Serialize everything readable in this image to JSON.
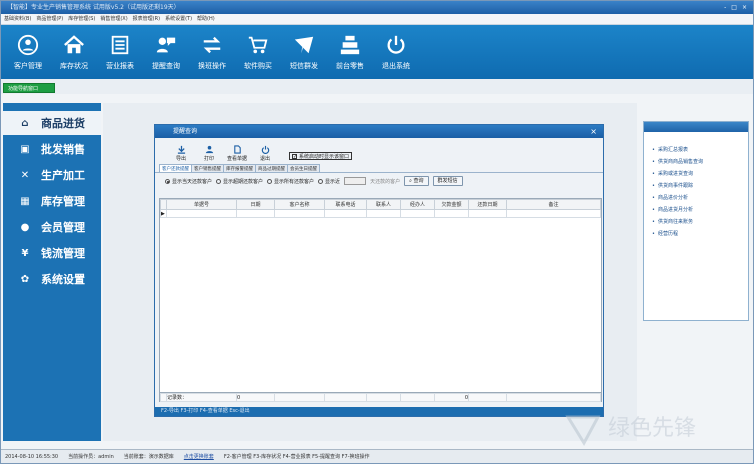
{
  "window": {
    "title": "【智能】专业生产销售管理系统  试用版v5.2（试用版还剩19天）",
    "controls": [
      "-",
      "□",
      "×"
    ]
  },
  "menubar": [
    "基础资料(B)",
    "商品管理(P)",
    "库存管理(S)",
    "销售管理(X)",
    "报表管理(R)",
    "系统设置(T)",
    "帮助(H)"
  ],
  "toolbar": [
    {
      "label": "客户管理",
      "icon": "customer-icon"
    },
    {
      "label": "库存状况",
      "icon": "home-icon"
    },
    {
      "label": "营业报表",
      "icon": "report-icon"
    },
    {
      "label": "提醒查询",
      "icon": "chat-icon"
    },
    {
      "label": "换班操作",
      "icon": "swap-icon"
    },
    {
      "label": "软件购买",
      "icon": "cart-icon"
    },
    {
      "label": "短信群发",
      "icon": "mail-icon"
    },
    {
      "label": "前台零售",
      "icon": "register-icon"
    },
    {
      "label": "退出系统",
      "icon": "power-icon"
    }
  ],
  "nav_tag": "功能导航窗口",
  "sidebar": [
    {
      "label": "商品进货",
      "icon": "store-icon",
      "active": true
    },
    {
      "label": "批发销售",
      "icon": "card-icon",
      "active": false
    },
    {
      "label": "生产加工",
      "icon": "tools-icon",
      "active": false
    },
    {
      "label": "库存管理",
      "icon": "grid-icon",
      "active": false
    },
    {
      "label": "会员管理",
      "icon": "person-icon",
      "active": false
    },
    {
      "label": "钱流管理",
      "icon": "yen-icon",
      "active": false
    },
    {
      "label": "系统设置",
      "icon": "gear-icon",
      "active": false
    }
  ],
  "right_panel": {
    "links": [
      "采购汇总报表",
      "供货商商品销售查询",
      "采购或进货查询",
      "供货商事件跟踪",
      "商品进价分析",
      "商品进货月分析",
      "供货商往来账务",
      "经营历程"
    ]
  },
  "dialog": {
    "title": "提醒查询",
    "tools": [
      {
        "label": "导出",
        "icon": "export-icon"
      },
      {
        "label": "打印",
        "icon": "print-icon"
      },
      {
        "label": "查看单据",
        "icon": "document-icon"
      },
      {
        "label": "退出",
        "icon": "exit-icon"
      }
    ],
    "startup_checkbox": {
      "label": "系统启动时显示该窗口",
      "checked": true
    },
    "tabs": [
      "客户还款提醒",
      "客户销售提醒",
      "库存报警提醒",
      "商品过期提醒",
      "会员生日提醒"
    ],
    "active_tab": 0,
    "filters": [
      {
        "label": "显示当天还款客户",
        "selected": true
      },
      {
        "label": "显示超期还款客户",
        "selected": false
      },
      {
        "label": "显示所有还款客户",
        "selected": false
      },
      {
        "label": "显示近",
        "selected": false
      }
    ],
    "days_placeholder": "",
    "days_suffix": "天还款的客户",
    "query_button": "查询",
    "sms_button": "群发短信",
    "columns": [
      "单据号",
      "日期",
      "客户名称",
      "联系电话",
      "联系人",
      "经办人",
      "欠款金额",
      "还款日期",
      "备注"
    ],
    "footer": {
      "label": "记录数：",
      "count": "0",
      "amount": "0"
    },
    "status": "F2-导出 F3-打印 F4-查看单据 Esc-退出"
  },
  "statusbar": {
    "datetime": "2014-08-10 16:55:30",
    "operator": "当前操作员：admin",
    "account": "当前账套：演示数据库",
    "link": "点击更换账套",
    "shortcuts": "F2-客户管理  F3-库存状况  F4-营业报表  F5-提醒查询  F7-换班操作"
  },
  "watermark": "绿色先锋",
  "colors": {
    "toolbar": "#1477c0",
    "sidebar": "#1c72b4",
    "accent_green": "#1d9e43"
  }
}
